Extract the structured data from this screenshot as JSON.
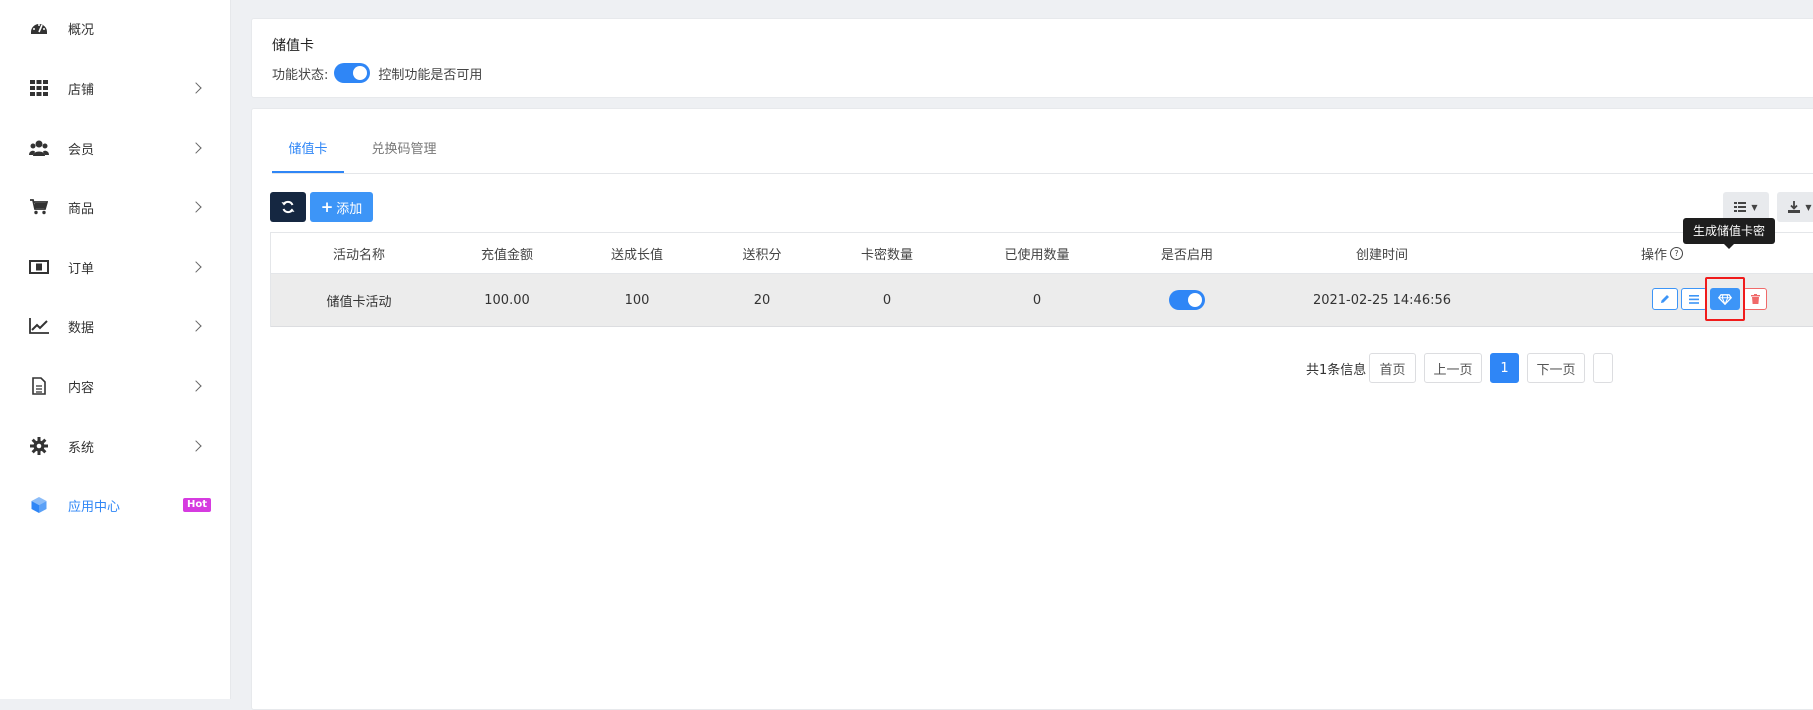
{
  "sidebar": {
    "items": [
      {
        "label": "概况",
        "icon": "dashboard-icon"
      },
      {
        "label": "店铺",
        "icon": "grid-icon"
      },
      {
        "label": "会员",
        "icon": "users-icon"
      },
      {
        "label": "商品",
        "icon": "cart-icon"
      },
      {
        "label": "订单",
        "icon": "money-icon"
      },
      {
        "label": "数据",
        "icon": "chart-line-icon"
      },
      {
        "label": "内容",
        "icon": "document-icon"
      },
      {
        "label": "系统",
        "icon": "gear-icon"
      },
      {
        "label": "应用中心",
        "icon": "cube-icon",
        "badge": "Hot"
      }
    ]
  },
  "feature": {
    "title": "储值卡",
    "status_label": "功能状态:",
    "status_desc": "控制功能是否可用",
    "enabled": true
  },
  "tabs": [
    "储值卡",
    "兑换码管理"
  ],
  "toolbar": {
    "add_label": "添加"
  },
  "table": {
    "headers": [
      "活动名称",
      "充值金额",
      "送成长值",
      "送积分",
      "卡密数量",
      "已使用数量",
      "是否启用",
      "创建时间",
      "操作"
    ],
    "rows": [
      {
        "name": "储值卡活动",
        "amount": "100.00",
        "growth": "100",
        "points": "20",
        "card_count": "0",
        "used_count": "0",
        "enabled": true,
        "created": "2021-02-25 14:46:56"
      }
    ]
  },
  "tooltip": "生成储值卡密",
  "pagination": {
    "total": "共1条信息",
    "first": "首页",
    "prev": "上一页",
    "current": "1",
    "next": "下一页"
  },
  "colors": {
    "accent": "#2f86f6",
    "dark_button": "#152741",
    "hot_badge": "#d63be0",
    "highlight": "#f01b1b"
  }
}
